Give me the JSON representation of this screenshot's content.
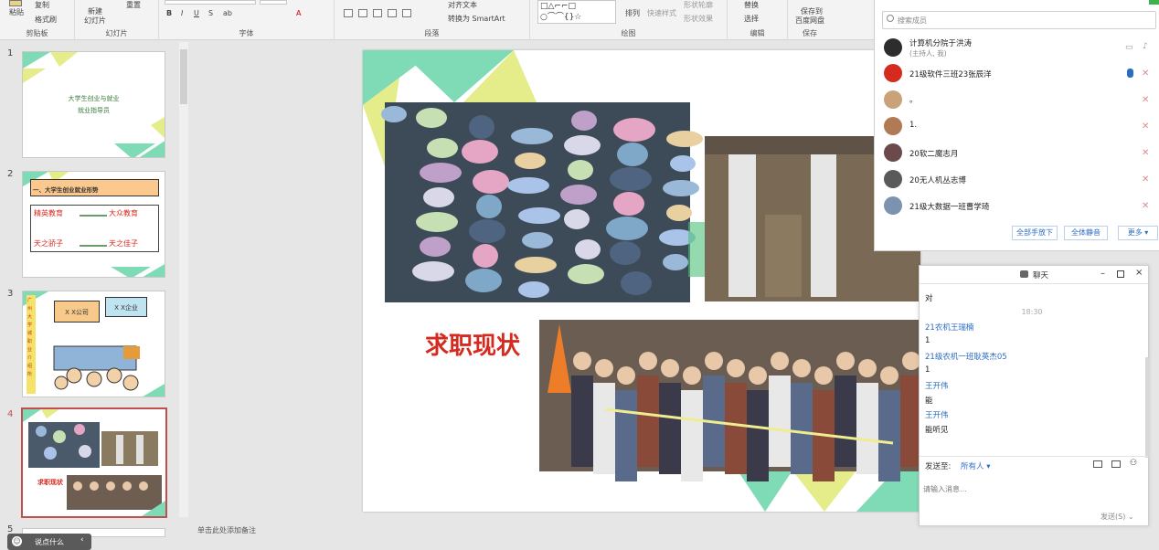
{
  "ribbon": {
    "paste": "粘贴",
    "copy": "复制",
    "format_painter": "格式刷",
    "clipboard": "剪贴板",
    "new_slide_1": "新建",
    "new_slide_2": "幻灯片",
    "reset": "重置",
    "slides": "幻灯片",
    "font": "字体",
    "align_text": "对齐文本",
    "smartart": "转换为 SmartArt",
    "paragraph": "段落",
    "arrange": "排列",
    "quick_styles": "快速样式",
    "shape_outline": "形状轮廓",
    "shape_effects": "形状效果",
    "drawing": "绘图",
    "replace": "替换",
    "select": "选择",
    "editing": "编辑",
    "save_1": "保存到",
    "save_2": "百度网盘",
    "save": "保存"
  },
  "thumbs": {
    "numbers": [
      "1",
      "2",
      "3",
      "4",
      "5"
    ],
    "s1_title_1": "大学生创业与就业",
    "s1_title_2": "就业指导员",
    "s2_heading": "一、大学生创业就业形势",
    "s2_l1a": "精英教育",
    "s2_l1b": "大众教育",
    "s2_l2a": "天之骄子",
    "s2_l2b": "天之佳子",
    "s3_sign1": "X X公司",
    "s3_sign2": "X X企业",
    "s3_side": "广州大学城职业介绍所",
    "s4_title": "求职现状"
  },
  "hint": "说点什么",
  "notes": "单击此处添加备注",
  "slide": {
    "title": "求职现状"
  },
  "members": {
    "search_placeholder": "搜索成员",
    "list": [
      {
        "name": "计算机分院于洪涛",
        "sub": "(主持人, 我)"
      },
      {
        "name": "21级软件三班23张辰洋",
        "sub": ""
      },
      {
        "name": "。",
        "sub": ""
      },
      {
        "name": "1.",
        "sub": ""
      },
      {
        "name": "20软二魔志月",
        "sub": ""
      },
      {
        "name": "20无人机丛志博",
        "sub": ""
      },
      {
        "name": "21级大数据一班曹学琦",
        "sub": ""
      }
    ],
    "btn_lower_hands": "全部手放下",
    "btn_mute_all": "全体静音",
    "btn_more": "更多"
  },
  "chat": {
    "title": "聊天",
    "messages": [
      {
        "text": "对",
        "kind": "msg"
      },
      {
        "text": "18:30",
        "kind": "time"
      },
      {
        "text": "21农机王瑞楠",
        "kind": "name"
      },
      {
        "text": "1",
        "kind": "msg"
      },
      {
        "text": "21级农机一班耿英杰05",
        "kind": "name"
      },
      {
        "text": "1",
        "kind": "msg"
      },
      {
        "text": "王开伟",
        "kind": "name"
      },
      {
        "text": "能",
        "kind": "msg"
      },
      {
        "text": "王开伟",
        "kind": "name"
      },
      {
        "text": "能听见",
        "kind": "msg"
      }
    ],
    "send_to_label": "发送至:",
    "send_to_value": "所有人",
    "input_placeholder": "请输入消息…",
    "send_button": "发送(S)"
  },
  "colors": {
    "accent_red": "#d42a1f",
    "mint": "#7fdbb6",
    "lime": "#e5ec8a",
    "link_blue": "#2b6cc4"
  }
}
